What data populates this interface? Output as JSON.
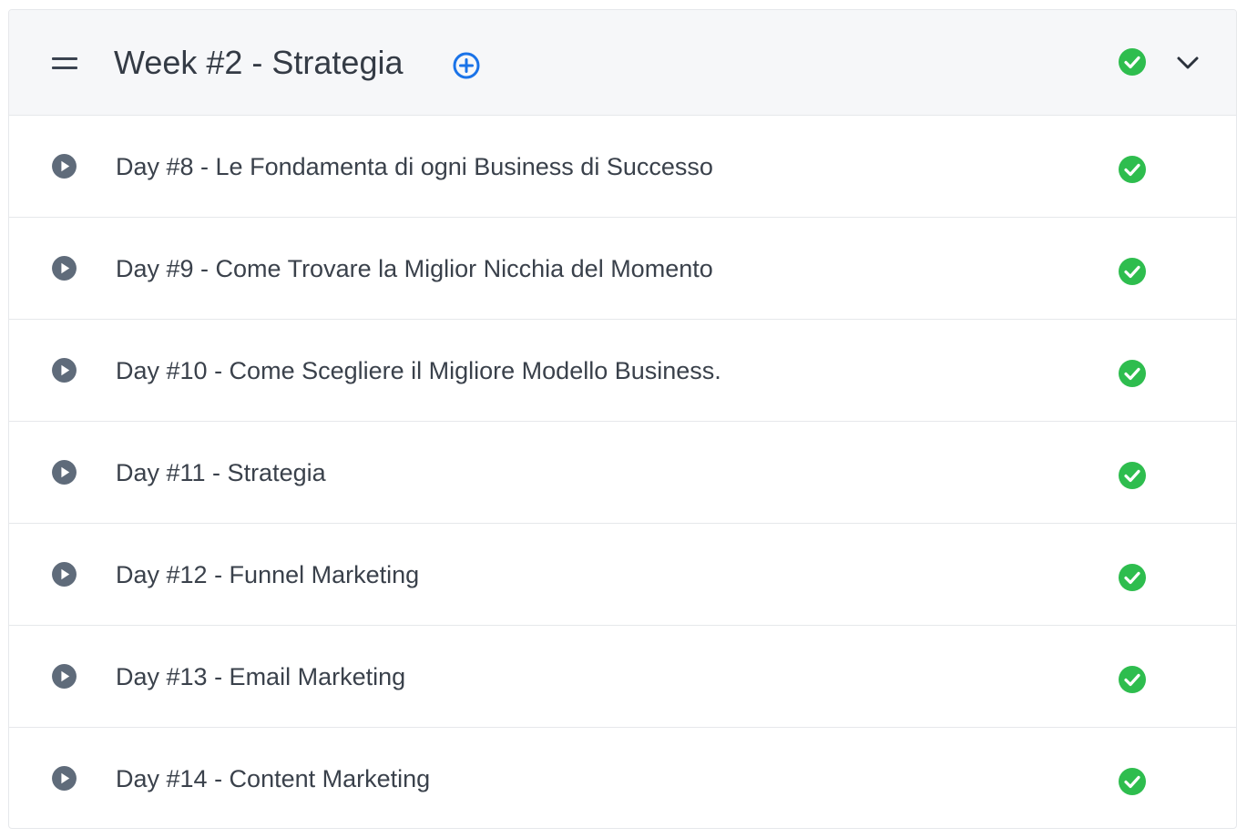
{
  "section": {
    "title": "Week #2 - Strategia",
    "completed": true,
    "expanded": true
  },
  "lessons": [
    {
      "title": "Day #8 - Le Fondamenta di ogni Business di Successo",
      "completed": true
    },
    {
      "title": "Day #9 - Come Trovare la Miglior Nicchia del Momento",
      "completed": true
    },
    {
      "title": "Day #10 - Come Scegliere il Migliore Modello Business.",
      "completed": true
    },
    {
      "title": "Day #11 - Strategia",
      "completed": true
    },
    {
      "title": "Day #12 - Funnel Marketing",
      "completed": true
    },
    {
      "title": "Day #13 - Email Marketing",
      "completed": true
    },
    {
      "title": "Day #14 - Content Marketing",
      "completed": true
    }
  ],
  "icons": {
    "drag": "drag-handle-icon",
    "add": "plus-circle-icon",
    "check": "check-circle-icon",
    "expand": "chevron-down-icon",
    "play": "play-circle-icon"
  },
  "colors": {
    "accent": "#1a73e8",
    "success": "#2ebd4e",
    "icon": "#5f6b7a",
    "text": "#343b45",
    "header_bg": "#f6f7f9",
    "border": "#e6e8eb"
  }
}
